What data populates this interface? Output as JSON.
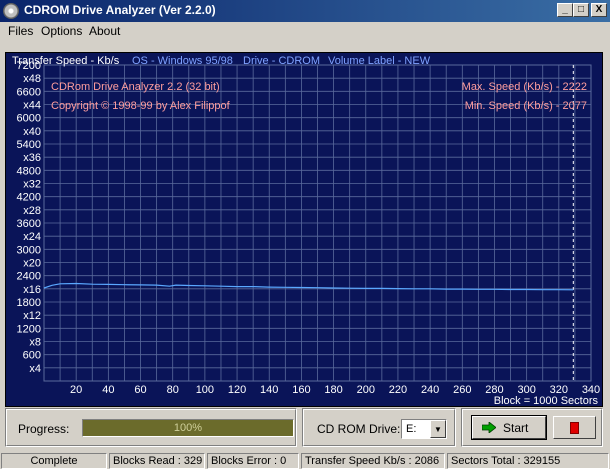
{
  "window": {
    "title": "CDROM Drive Analyzer (Ver 2.2.0)",
    "minimize_glyph": "_",
    "maximize_glyph": "□",
    "close_glyph": "X"
  },
  "menu": {
    "files": "Files",
    "options": "Options",
    "about": "About"
  },
  "chart_header": {
    "transfer_label": "Transfer Speed - Kb/s",
    "os": "OS - Windows 95/98",
    "drive": "Drive - CDROM",
    "volume": "Volume Label - NEW"
  },
  "chart_overlay": {
    "app_name": "CDRom Drive Analyzer 2.2 (32 bit)",
    "copyright": "Copyright © 1998-99 by Alex Filippof",
    "max_speed": "Max. Speed (Kb/s) - 2222",
    "min_speed": "Min.  Speed (Kb/s) - 2077",
    "block_note": "Block = 1000 Sectors"
  },
  "chart_data": {
    "type": "line",
    "x_ticks": [
      "20",
      "40",
      "60",
      "80",
      "100",
      "120",
      "140",
      "160",
      "180",
      "200",
      "220",
      "240",
      "260",
      "280",
      "300",
      "320",
      "340"
    ],
    "y_tick_pairs": [
      [
        "7200",
        "x48"
      ],
      [
        "6600",
        "x44"
      ],
      [
        "6000",
        "x40"
      ],
      [
        "5400",
        "x36"
      ],
      [
        "4800",
        "x32"
      ],
      [
        "4200",
        "x28"
      ],
      [
        "3600",
        "x24"
      ],
      [
        "3000",
        "x20"
      ],
      [
        "2400",
        "x16"
      ],
      [
        "1800",
        "x12"
      ],
      [
        "1200",
        "x8"
      ],
      [
        "600",
        "x4"
      ]
    ],
    "xlim": [
      0,
      340
    ],
    "ylim": [
      0,
      7200
    ],
    "grid": true,
    "series": [
      {
        "values": [
          [
            0,
            2120
          ],
          [
            5,
            2180
          ],
          [
            10,
            2215
          ],
          [
            20,
            2222
          ],
          [
            30,
            2205
          ],
          [
            40,
            2200
          ],
          [
            50,
            2195
          ],
          [
            60,
            2190
          ],
          [
            70,
            2185
          ],
          [
            78,
            2160
          ],
          [
            82,
            2185
          ],
          [
            90,
            2175
          ],
          [
            100,
            2170
          ],
          [
            110,
            2160
          ],
          [
            120,
            2150
          ],
          [
            130,
            2150
          ],
          [
            140,
            2140
          ],
          [
            150,
            2135
          ],
          [
            160,
            2130
          ],
          [
            170,
            2125
          ],
          [
            180,
            2120
          ],
          [
            190,
            2115
          ],
          [
            200,
            2110
          ],
          [
            210,
            2110
          ],
          [
            220,
            2105
          ],
          [
            230,
            2100
          ],
          [
            240,
            2100
          ],
          [
            250,
            2095
          ],
          [
            260,
            2095
          ],
          [
            270,
            2090
          ],
          [
            280,
            2090
          ],
          [
            290,
            2085
          ],
          [
            300,
            2085
          ],
          [
            310,
            2080
          ],
          [
            320,
            2080
          ],
          [
            329,
            2077
          ]
        ]
      }
    ],
    "marker_x": 329,
    "line_color": "#5aa8ff",
    "grid_color": "#5a6a9c",
    "background": "#0a1458"
  },
  "progress": {
    "label": "Progress:",
    "percent_text": "100%",
    "value": 1.0
  },
  "drive": {
    "label": "CD ROM Drive:",
    "selected": "E:"
  },
  "buttons": {
    "start": "Start"
  },
  "status": {
    "state": "Complete",
    "blocks_read": "Blocks Read : 329",
    "blocks_error": "Blocks Error : 0",
    "transfer_speed": "Transfer Speed Kb/s : 2086",
    "sectors_total": "Sectors Total : 329155"
  }
}
